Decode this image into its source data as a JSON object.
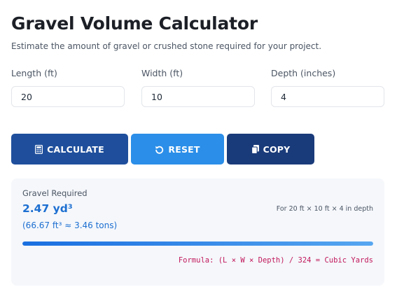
{
  "header": {
    "title": "Gravel Volume Calculator",
    "subtitle": "Estimate the amount of gravel or crushed stone required for your project."
  },
  "inputs": {
    "length": {
      "label": "Length (ft)",
      "value": "20"
    },
    "width": {
      "label": "Width (ft)",
      "value": "10"
    },
    "depth": {
      "label": "Depth (inches)",
      "value": "4"
    }
  },
  "buttons": {
    "calculate": {
      "label": "CALCULATE",
      "icon": "calculator-icon"
    },
    "reset": {
      "label": "RESET",
      "icon": "undo-icon"
    },
    "copy": {
      "label": "COPY",
      "icon": "copy-icon"
    }
  },
  "result": {
    "label": "Gravel Required",
    "value": "2.47 yd³",
    "conversion": "(66.67 ft³ ≈ 3.46 tons)",
    "dimensions": "For 20 ft × 10 ft × 4 in depth",
    "progress": 1.0,
    "formula": "Formula: (L × W × Depth) / 324 = Cubic Yards"
  },
  "colors": {
    "calculate_button": "#1f4f9c",
    "reset_button": "#2b8ee8",
    "copy_button": "#1a3b7a",
    "result_accent": "#1d6fd1",
    "formula_text": "#c2185b"
  }
}
